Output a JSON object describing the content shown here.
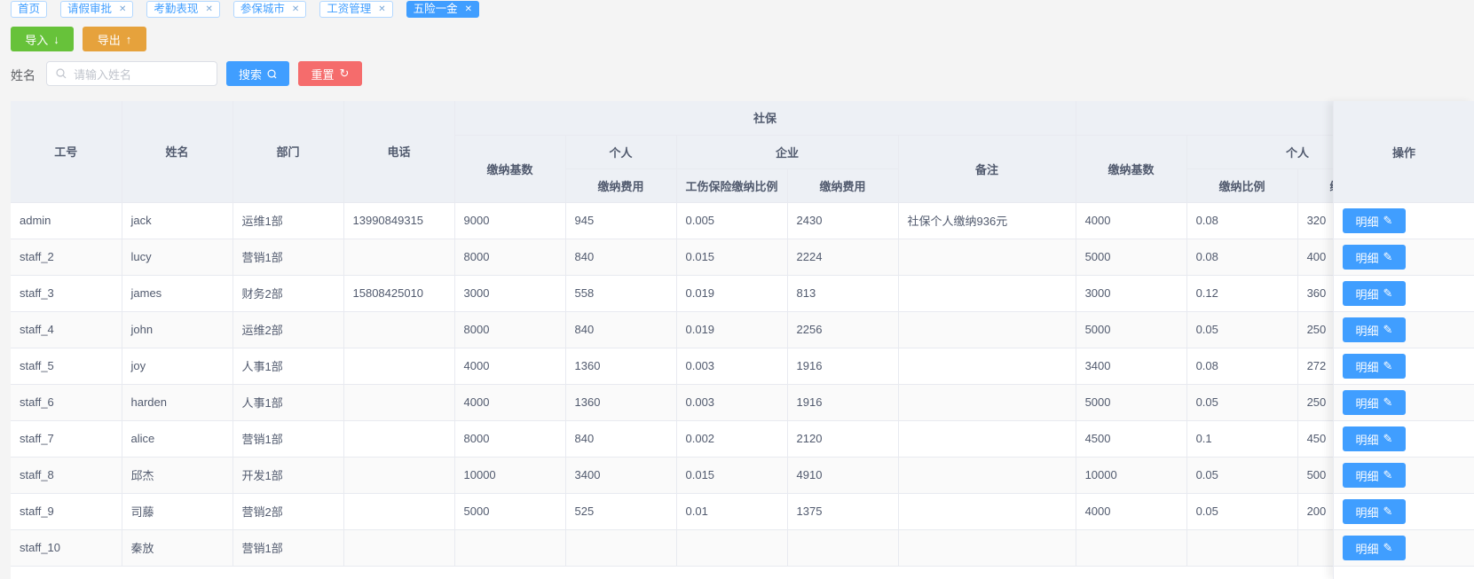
{
  "tabs": [
    {
      "label": "首页",
      "closable": false
    },
    {
      "label": "请假审批",
      "closable": true
    },
    {
      "label": "考勤表现",
      "closable": true
    },
    {
      "label": "参保城市",
      "closable": true
    },
    {
      "label": "工资管理",
      "closable": true
    },
    {
      "label": "五险一金",
      "closable": true,
      "active": true
    }
  ],
  "toolbar": {
    "import_label": "导入",
    "export_label": "导出",
    "import_color": "#67c23a",
    "export_color": "#e6a23c"
  },
  "search": {
    "label": "姓名",
    "placeholder": "请输入姓名",
    "value": "",
    "search_label": "搜索",
    "reset_label": "重置",
    "search_color": "#409eff",
    "reset_color": "#f56c6c"
  },
  "table": {
    "headers": {
      "id": "工号",
      "name": "姓名",
      "dept": "部门",
      "phone": "电话",
      "social": "社保",
      "base": "缴纳基数",
      "personal": "个人",
      "company": "企业",
      "fee": "缴纳费用",
      "injury_ratio": "工伤保险缴纳比例",
      "remark": "备注",
      "fund_base": "缴纳基数",
      "fund_personal": "个人",
      "ratio": "缴纳比例",
      "fund_fee": "缴纳费用",
      "action": "操作"
    },
    "action_label": "明细",
    "rows": [
      {
        "id": "admin",
        "name": "jack",
        "dept": "运维1部",
        "phone": "13990849315",
        "base": "9000",
        "pfee": "945",
        "ratio": "0.005",
        "cfee": "2430",
        "remark": "社保个人缴纳936元",
        "fbase": "4000",
        "fratio": "0.08",
        "ffee": "320"
      },
      {
        "id": "staff_2",
        "name": "lucy",
        "dept": "营销1部",
        "phone": "",
        "base": "8000",
        "pfee": "840",
        "ratio": "0.015",
        "cfee": "2224",
        "remark": "",
        "fbase": "5000",
        "fratio": "0.08",
        "ffee": "400"
      },
      {
        "id": "staff_3",
        "name": "james",
        "dept": "财务2部",
        "phone": "15808425010",
        "base": "3000",
        "pfee": "558",
        "ratio": "0.019",
        "cfee": "813",
        "remark": "",
        "fbase": "3000",
        "fratio": "0.12",
        "ffee": "360"
      },
      {
        "id": "staff_4",
        "name": "john",
        "dept": "运维2部",
        "phone": "",
        "base": "8000",
        "pfee": "840",
        "ratio": "0.019",
        "cfee": "2256",
        "remark": "",
        "fbase": "5000",
        "fratio": "0.05",
        "ffee": "250"
      },
      {
        "id": "staff_5",
        "name": "joy",
        "dept": "人事1部",
        "phone": "",
        "base": "4000",
        "pfee": "1360",
        "ratio": "0.003",
        "cfee": "1916",
        "remark": "",
        "fbase": "3400",
        "fratio": "0.08",
        "ffee": "272"
      },
      {
        "id": "staff_6",
        "name": "harden",
        "dept": "人事1部",
        "phone": "",
        "base": "4000",
        "pfee": "1360",
        "ratio": "0.003",
        "cfee": "1916",
        "remark": "",
        "fbase": "5000",
        "fratio": "0.05",
        "ffee": "250"
      },
      {
        "id": "staff_7",
        "name": "alice",
        "dept": "营销1部",
        "phone": "",
        "base": "8000",
        "pfee": "840",
        "ratio": "0.002",
        "cfee": "2120",
        "remark": "",
        "fbase": "4500",
        "fratio": "0.1",
        "ffee": "450"
      },
      {
        "id": "staff_8",
        "name": "邱杰",
        "dept": "开发1部",
        "phone": "",
        "base": "10000",
        "pfee": "3400",
        "ratio": "0.015",
        "cfee": "4910",
        "remark": "",
        "fbase": "10000",
        "fratio": "0.05",
        "ffee": "500"
      },
      {
        "id": "staff_9",
        "name": "司藤",
        "dept": "营销2部",
        "phone": "",
        "base": "5000",
        "pfee": "525",
        "ratio": "0.01",
        "cfee": "1375",
        "remark": "",
        "fbase": "4000",
        "fratio": "0.05",
        "ffee": "200"
      },
      {
        "id": "staff_10",
        "name": "秦放",
        "dept": "营销1部",
        "phone": "",
        "base": "",
        "pfee": "",
        "ratio": "",
        "cfee": "",
        "remark": "",
        "fbase": "",
        "fratio": "",
        "ffee": ""
      }
    ]
  }
}
